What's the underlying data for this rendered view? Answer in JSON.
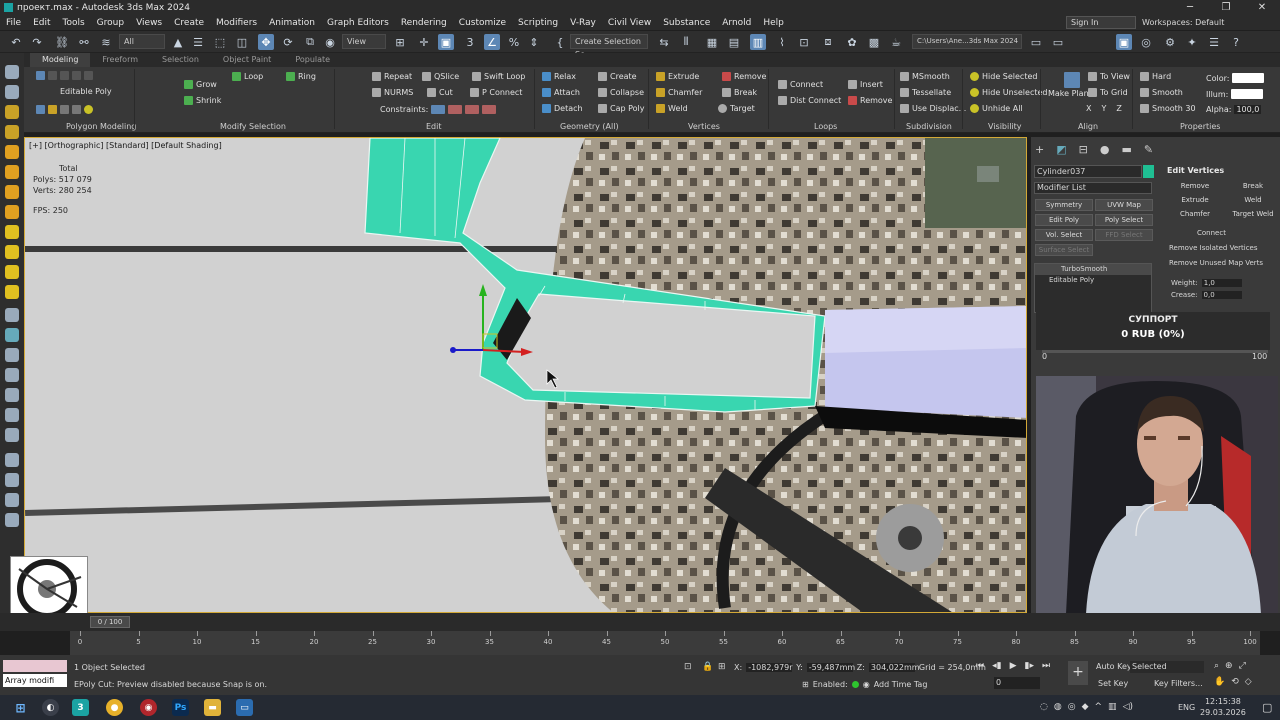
{
  "window": {
    "title": "проект.max - Autodesk 3ds Max 2024",
    "controls": [
      "─",
      "❐",
      "✕"
    ]
  },
  "menu": [
    "File",
    "Edit",
    "Tools",
    "Group",
    "Views",
    "Create",
    "Modifiers",
    "Animation",
    "Graph Editors",
    "Rendering",
    "Customize",
    "Scripting",
    "V-Ray",
    "Civil View",
    "Substance",
    "Arnold",
    "Help"
  ],
  "account": {
    "sign_in": "Sign In",
    "workspaces": "Workspaces: Default"
  },
  "toolbar": {
    "filter": "All",
    "ref_coord": "View",
    "selection_set": "Create Selection Se",
    "path": "C:\\Users\\Ane...3ds Max 2024"
  },
  "ribbon_tabs": [
    "Modeling",
    "Freeform",
    "Selection",
    "Object Paint",
    "Populate"
  ],
  "ribbon": {
    "poly_label": "Editable Poly",
    "groups": [
      "Polygon Modeling",
      "Modify Selection",
      "Edit",
      "Geometry (All)",
      "Vertices",
      "Loops",
      "Subdivision",
      "Visibility",
      "Align",
      "Properties"
    ],
    "modify_sel": [
      "Grow",
      "Shrink",
      "Loop",
      "Ring"
    ],
    "edit": [
      "Repeat",
      "QSlice",
      "Swift Loop",
      "NURMS",
      "Cut",
      "P Connect",
      "Constraints:"
    ],
    "geometry": [
      "Relax",
      "Create",
      "Attach",
      "Collapse",
      "Detach",
      "Cap Poly"
    ],
    "vertices": [
      "Extrude",
      "Remove",
      "Chamfer",
      "Break",
      "Weld",
      "Target"
    ],
    "loops": [
      "Connect",
      "Insert",
      "Dist Connect",
      "Remove"
    ],
    "subdivision": [
      "MSmooth",
      "Tessellate",
      "Use Displac..."
    ],
    "visibility": [
      "Hide Selected",
      "Hide Unselected",
      "Unhide All"
    ],
    "align": [
      "Make Planar",
      "To View",
      "To Grid",
      "X",
      "Y",
      "Z"
    ],
    "properties": [
      "Hard",
      "Smooth",
      "Smooth 30",
      "Color:",
      "Illum:",
      "Alpha:",
      "100,0"
    ]
  },
  "viewport": {
    "label": "[+] [Orthographic] [Standard] [Default Shading]",
    "stats_total": "Total",
    "polys": "Polys:  517 079",
    "verts": "Verts:  280 254",
    "fps": "FPS:    250"
  },
  "command_panel": {
    "object_name": "Cylinder037",
    "object_color": "#1fbf93",
    "modifier_list": "Modifier List",
    "buttons": [
      "Symmetry",
      "UVW Map",
      "Edit Poly",
      "Poly Select",
      "Vol. Select",
      "FFD Select",
      "Surface Select"
    ],
    "stack": [
      "TurboSmooth",
      "Editable Poly"
    ],
    "rollout_title": "Edit Vertices",
    "edit_vertices": [
      "Remove",
      "Break",
      "Extrude",
      "Weld",
      "Chamfer",
      "Target Weld",
      "Connect",
      "Remove Isolated Vertices",
      "Remove Unused Map Verts"
    ],
    "weight_label": "Weight:",
    "weight_value": "1,0",
    "crease_label": "Crease:",
    "crease_value": "0,0"
  },
  "support_widget": {
    "title": "СУППОРТ",
    "amount": "0 RUB (0%)",
    "min": "0",
    "max": "100",
    "progress": 0
  },
  "timeline": {
    "frames": [
      "0",
      "5",
      "10",
      "15",
      "20",
      "25",
      "30",
      "35",
      "40",
      "45",
      "50",
      "55",
      "60",
      "65",
      "70",
      "75",
      "80",
      "85",
      "90",
      "95",
      "100"
    ],
    "slider": "0 / 100"
  },
  "status": {
    "macro": "Array modifi",
    "selected": "1 Object Selected",
    "prompt": "EPoly Cut: Preview disabled because Snap is on.",
    "x": "-1082,979r",
    "y": "-59,487mm",
    "z": "304,022mm",
    "grid": "Grid = 254,0mm",
    "enabled": "Enabled:",
    "add_time_tag": "Add Time Tag",
    "auto_key": "Auto Key",
    "set_key": "Set Key",
    "selected_dd": "Selected",
    "key_filters": "Key Filters...",
    "frame": "0"
  },
  "taskbar": {
    "time": "12:15:38",
    "date": "29.03.2026",
    "lang": "ENG"
  }
}
